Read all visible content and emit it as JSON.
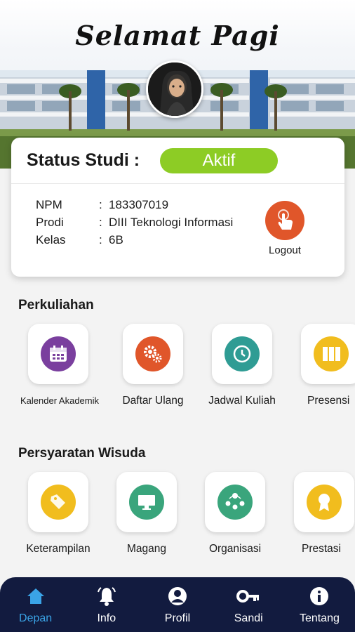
{
  "header": {
    "greeting": "Selamat Pagi"
  },
  "status": {
    "label": "Status Studi :",
    "value": "Aktif"
  },
  "student": {
    "rows": [
      {
        "key": "NPM",
        "value": "183307019"
      },
      {
        "key": "Prodi",
        "value": "DIII Teknologi Informasi"
      },
      {
        "key": "Kelas",
        "value": "6B"
      }
    ],
    "separator": ":"
  },
  "logout": {
    "label": "Logout"
  },
  "perkuliahan": {
    "title": "Perkuliahan",
    "items": [
      {
        "label": "Kalender Akademik",
        "icon": "calendar-icon",
        "color": "#7a3f9e"
      },
      {
        "label": "Daftar Ulang",
        "icon": "gears-icon",
        "color": "#e0562a"
      },
      {
        "label": "Jadwal Kuliah",
        "icon": "clock-icon",
        "color": "#2f9c94"
      },
      {
        "label": "Presensi",
        "icon": "binders-icon",
        "color": "#f1bd1e"
      }
    ]
  },
  "wisuda": {
    "title": "Persyaratan Wisuda",
    "items": [
      {
        "label": "Keterampilan",
        "icon": "tag-icon",
        "color": "#f1bd1e"
      },
      {
        "label": "Magang",
        "icon": "monitor-icon",
        "color": "#3aa57c"
      },
      {
        "label": "Organisasi",
        "icon": "people-icon",
        "color": "#3aa57c"
      },
      {
        "label": "Prestasi",
        "icon": "medal-icon",
        "color": "#f1bd1e"
      }
    ]
  },
  "nav": {
    "items": [
      {
        "label": "Depan",
        "icon": "home-icon",
        "active": true
      },
      {
        "label": "Info",
        "icon": "bell-icon"
      },
      {
        "label": "Profil",
        "icon": "user-icon"
      },
      {
        "label": "Sandi",
        "icon": "key-icon"
      },
      {
        "label": "Tentang",
        "icon": "info-icon"
      }
    ]
  },
  "colors": {
    "accent": "#8dcc25",
    "nav_bg": "#121b3f",
    "nav_active": "#3aa3e6",
    "logout": "#e0562a"
  }
}
